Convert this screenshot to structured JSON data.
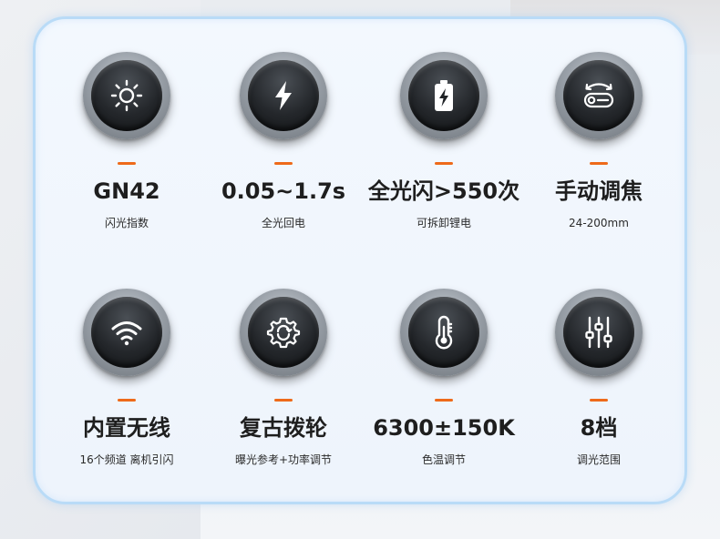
{
  "features": [
    {
      "icon": "sun-icon",
      "title": "GN42",
      "subtitle": "闪光指数"
    },
    {
      "icon": "lightning-icon",
      "title": "0.05~1.7s",
      "subtitle": "全光回电"
    },
    {
      "icon": "battery-icon",
      "title": "全光闪>550次",
      "subtitle": "可拆卸锂电"
    },
    {
      "icon": "zoom-icon",
      "title": "手动调焦",
      "subtitle": "24-200mm"
    },
    {
      "icon": "wifi-icon",
      "title": "内置无线",
      "subtitle": "16个频道 离机引闪"
    },
    {
      "icon": "refresh-gear-icon",
      "title": "复古拨轮",
      "subtitle": "曝光参考+功率调节"
    },
    {
      "icon": "thermometer-icon",
      "title": "6300±150K",
      "subtitle": "色温调节"
    },
    {
      "icon": "sliders-icon",
      "title": "8档",
      "subtitle": "调光范围"
    }
  ],
  "colors": {
    "accent": "#ee6a1a",
    "panel_border": "#b9dbf7",
    "icon_glyph": "#ffffff"
  }
}
